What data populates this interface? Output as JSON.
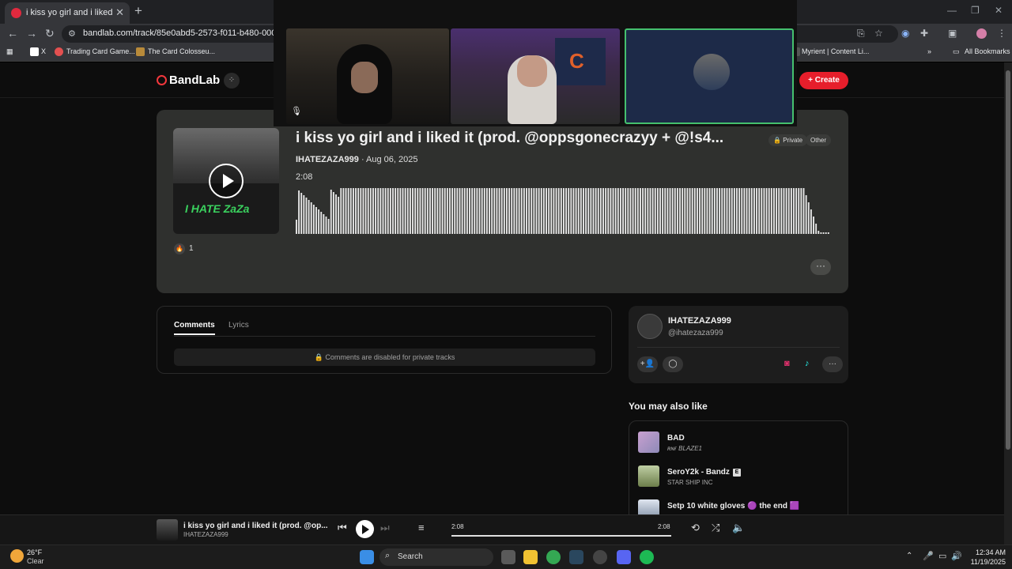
{
  "browser": {
    "tab_title": "i kiss yo girl and i liked it (prod.",
    "url": "bandlab.com/track/85e0abd5-2573-f011-b480-000d3aa44",
    "bookmarks": [
      "X",
      "Trading Card Game...",
      "The Card Colosseu...",
      "Myrient | Content Li...",
      "All Bookmarks"
    ]
  },
  "site": {
    "logo": "BandLab",
    "create_label": "Create"
  },
  "track": {
    "title": "i kiss yo girl and i liked it (prod. @oppsgonecrazyy + @!s4...",
    "privacy_badge": "Private",
    "genre_badge": "Other",
    "artist": "IHATEZAZA999",
    "date": "· Aug 06, 2025",
    "duration": "2:08",
    "cover_text": "I HATE ZaZa",
    "reaction_count": "1",
    "more_label": "···"
  },
  "comments": {
    "tab_comments": "Comments",
    "tab_lyrics": "Lyrics",
    "disabled_message": "Comments are disabled for private tracks"
  },
  "artist_card": {
    "name": "IHATEZAZA999",
    "handle": "@ihatezaza999"
  },
  "recommendations": {
    "heading": "You may also like",
    "items": [
      {
        "title": "BAD",
        "artist": "ʀɴғ BLAZE1"
      },
      {
        "title": "SeroY2k - Bandz",
        "artist": "STAR SHIP INC",
        "explicit": "E"
      },
      {
        "title": "Setp 10 white gloves 🟣 the end 🟪",
        "artist": ""
      }
    ]
  },
  "player": {
    "title": "i kiss yo girl and i liked it (prod. @op...",
    "artist": "IHATEZAZA999",
    "current_time": "2:08",
    "total_time": "2:08",
    "progress": 1.0
  },
  "taskbar": {
    "temp": "26°F",
    "condition": "Clear",
    "search_label": "Search",
    "time": "12:34 AM",
    "date": "11/19/2025"
  },
  "colors": {
    "accent": "#e61e2b",
    "card_bg": "#2f302e"
  }
}
